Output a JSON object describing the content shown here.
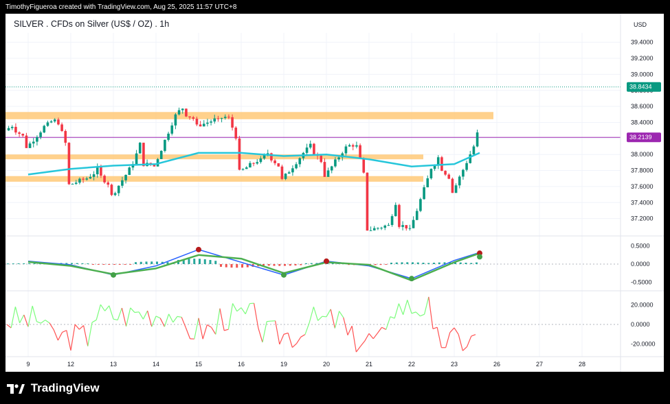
{
  "header": {
    "credit": "TimothyFigueroa created with TradingView.com, Aug 25, 2025 11:57 UTC+8"
  },
  "footer": {
    "brand_name": "TradingView",
    "brand_logo_icon": "tradingview-logo-icon"
  },
  "colors": {
    "up_candle": "#089981",
    "down_candle": "#f23645",
    "ema_line": "#26c6da",
    "zone_fill": "#ffcc80",
    "last_price_badge": "#089981",
    "marked_level_line": "#9c27b0",
    "macd_line": "#2962ff",
    "macd_hist_up": "#26a69a",
    "macd_hist_down": "#ef5350",
    "osc_up": "#7cfc7c",
    "osc_down": "#ff5252"
  },
  "chart_data": [
    {
      "type": "candlestick",
      "title": "SILVER . CFDs on Silver (US$ / OZ) . 1h",
      "currency": "USD",
      "ylim": [
        37.0,
        39.5
      ],
      "y_ticks": [
        "39.4000",
        "39.2000",
        "39.0000",
        "38.8000",
        "38.6000",
        "38.4000",
        "38.2000",
        "38.0000",
        "37.8000",
        "37.6000",
        "37.4000",
        "37.2000"
      ],
      "x_ticks": [
        "9",
        "12",
        "13",
        "14",
        "15",
        "16",
        "19",
        "20",
        "21",
        "22",
        "23",
        "26",
        "27",
        "28"
      ],
      "last_price": "38.8434",
      "marked_level": "38.2139",
      "sessions": [
        {
          "label": "8",
          "open": 38.3,
          "high": 38.48,
          "low": 38.08,
          "close": 38.4
        },
        {
          "label": "9",
          "open": 38.4,
          "high": 38.46,
          "low": 37.62,
          "close": 37.72
        },
        {
          "label": "12",
          "open": 37.72,
          "high": 38.0,
          "low": 37.48,
          "close": 37.88
        },
        {
          "label": "13",
          "open": 37.88,
          "high": 38.62,
          "low": 37.85,
          "close": 38.5
        },
        {
          "label": "14",
          "open": 38.5,
          "high": 38.74,
          "low": 38.35,
          "close": 38.45
        },
        {
          "label": "15",
          "open": 38.45,
          "high": 38.5,
          "low": 37.78,
          "close": 37.95
        },
        {
          "label": "16",
          "open": 37.95,
          "high": 38.16,
          "low": 37.68,
          "close": 38.02
        },
        {
          "label": "19",
          "open": 38.02,
          "high": 38.28,
          "low": 37.72,
          "close": 38.1
        },
        {
          "label": "20",
          "open": 38.1,
          "high": 38.16,
          "low": 37.05,
          "close": 37.12
        },
        {
          "label": "21",
          "open": 37.12,
          "high": 37.96,
          "low": 37.05,
          "close": 37.82
        },
        {
          "label": "22",
          "open": 37.82,
          "high": 38.25,
          "low": 37.52,
          "close": 38.1
        },
        {
          "label": "23",
          "open": 38.1,
          "high": 39.05,
          "low": 37.7,
          "close": 38.82
        }
      ],
      "ema": [
        {
          "x": "8",
          "y": 37.75
        },
        {
          "x": "9",
          "y": 37.82
        },
        {
          "x": "12",
          "y": 37.86
        },
        {
          "x": "13",
          "y": 37.88
        },
        {
          "x": "14",
          "y": 38.02
        },
        {
          "x": "15",
          "y": 38.02
        },
        {
          "x": "16",
          "y": 37.98
        },
        {
          "x": "19",
          "y": 38.0
        },
        {
          "x": "20",
          "y": 37.94
        },
        {
          "x": "21",
          "y": 37.85
        },
        {
          "x": "22",
          "y": 37.88
        },
        {
          "x": "23",
          "y": 38.02
        }
      ],
      "zones": [
        {
          "from": 38.44,
          "to": 38.53
        },
        {
          "from": 37.94,
          "to": 38.0
        },
        {
          "from": 37.66,
          "to": 37.73
        }
      ]
    },
    {
      "type": "line",
      "name": "MACD",
      "ylim": [
        -0.7,
        0.7
      ],
      "y_ticks": [
        "0.5000",
        "0.0000",
        "-0.5000"
      ],
      "series": [
        {
          "x": [
            "8",
            "9",
            "12",
            "13",
            "14",
            "15",
            "16",
            "19",
            "20",
            "21",
            "22",
            "23"
          ],
          "values": [
            0.08,
            -0.02,
            -0.3,
            -0.05,
            0.4,
            0.05,
            -0.3,
            0.08,
            -0.05,
            -0.4,
            0.1,
            0.32
          ]
        },
        {
          "x": [
            "8",
            "9",
            "12",
            "13",
            "14",
            "15",
            "16",
            "19",
            "20",
            "21",
            "22",
            "23"
          ],
          "values": [
            0.06,
            -0.05,
            -0.28,
            -0.12,
            0.25,
            0.15,
            -0.25,
            0.05,
            -0.02,
            -0.45,
            0.05,
            0.3
          ]
        }
      ],
      "histogram": [
        0.02,
        0.03,
        -0.02,
        0.07,
        0.15,
        -0.1,
        -0.05,
        0.03,
        -0.03,
        0.05,
        0.05,
        0.06
      ],
      "crossovers": [
        {
          "x": "12",
          "y": -0.3,
          "direction": "up"
        },
        {
          "x": "14",
          "y": 0.4,
          "direction": "down"
        },
        {
          "x": "16",
          "y": -0.3,
          "direction": "up"
        },
        {
          "x": "19",
          "y": 0.08,
          "direction": "down"
        },
        {
          "x": "21",
          "y": -0.4,
          "direction": "up"
        },
        {
          "x": "23",
          "y": 0.3,
          "direction": "down"
        },
        {
          "x": "23",
          "y": 0.2,
          "direction": "up"
        }
      ]
    },
    {
      "type": "line",
      "name": "Oscillator",
      "ylim": [
        -30,
        30
      ],
      "y_ticks": [
        "20.0000",
        "0.0000",
        "-20.0000"
      ],
      "series": [
        {
          "x": [
            "8",
            "9",
            "12",
            "13",
            "14",
            "15",
            "16",
            "19",
            "20",
            "21",
            "22",
            "23"
          ],
          "values": [
            5,
            -12,
            10,
            12,
            -5,
            8,
            -10,
            4,
            -15,
            18,
            -16,
            -10
          ]
        }
      ]
    }
  ]
}
